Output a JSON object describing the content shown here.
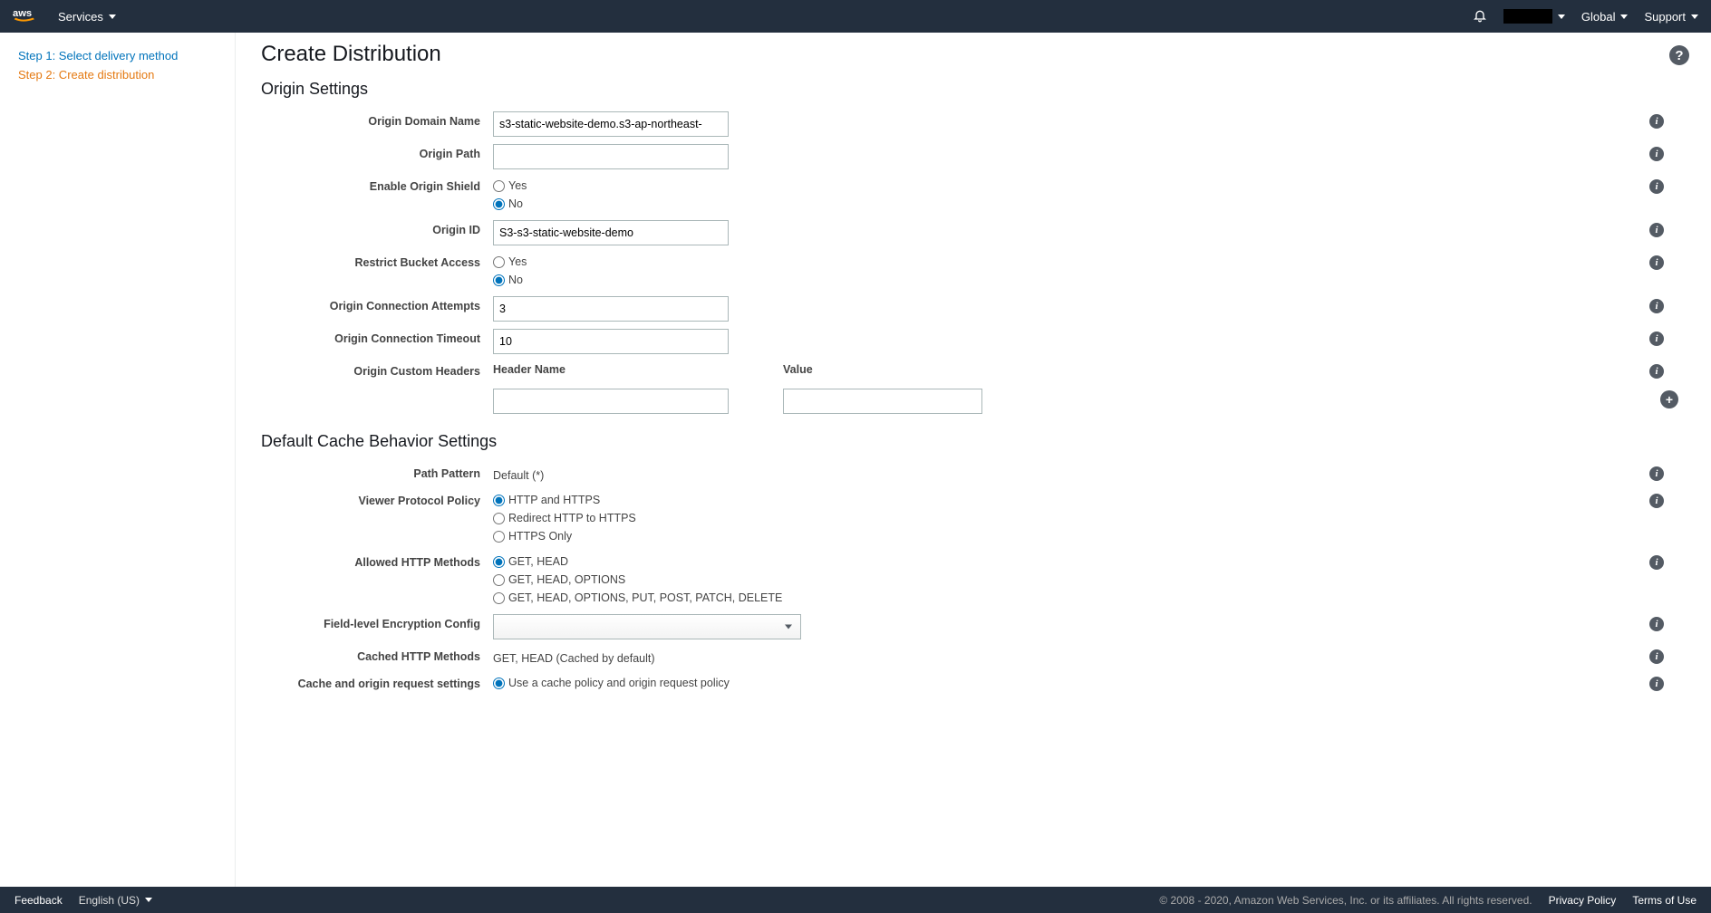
{
  "topbar": {
    "services": "Services",
    "global": "Global",
    "support": "Support"
  },
  "sidebar": {
    "step1": "Step 1: Select delivery method",
    "step2": "Step 2: Create distribution"
  },
  "page": {
    "title": "Create Distribution"
  },
  "origin": {
    "section_title": "Origin Settings",
    "domain_name_label": "Origin Domain Name",
    "domain_name_value": "s3-static-website-demo.s3-ap-northeast-",
    "path_label": "Origin Path",
    "path_value": "",
    "shield_label": "Enable Origin Shield",
    "shield_yes": "Yes",
    "shield_no": "No",
    "id_label": "Origin ID",
    "id_value": "S3-s3-static-website-demo",
    "restrict_label": "Restrict Bucket Access",
    "restrict_yes": "Yes",
    "restrict_no": "No",
    "attempts_label": "Origin Connection Attempts",
    "attempts_value": "3",
    "timeout_label": "Origin Connection Timeout",
    "timeout_value": "10",
    "custom_headers_label": "Origin Custom Headers",
    "header_name": "Header Name",
    "header_value": "Value"
  },
  "cache": {
    "section_title": "Default Cache Behavior Settings",
    "path_pattern_label": "Path Pattern",
    "path_pattern_value": "Default (*)",
    "viewer_protocol_label": "Viewer Protocol Policy",
    "viewer_http_https": "HTTP and HTTPS",
    "viewer_redirect": "Redirect HTTP to HTTPS",
    "viewer_https_only": "HTTPS Only",
    "allowed_methods_label": "Allowed HTTP Methods",
    "allowed_get_head": "GET, HEAD",
    "allowed_get_head_options": "GET, HEAD, OPTIONS",
    "allowed_all": "GET, HEAD, OPTIONS, PUT, POST, PATCH, DELETE",
    "field_enc_label": "Field-level Encryption Config",
    "cached_methods_label": "Cached HTTP Methods",
    "cached_methods_value": "GET, HEAD (Cached by default)",
    "cache_settings_label": "Cache and origin request settings",
    "cache_policy_option": "Use a cache policy and origin request policy"
  },
  "footer": {
    "feedback": "Feedback",
    "language": "English (US)",
    "copyright": "© 2008 - 2020, Amazon Web Services, Inc. or its affiliates. All rights reserved.",
    "privacy": "Privacy Policy",
    "terms": "Terms of Use"
  }
}
